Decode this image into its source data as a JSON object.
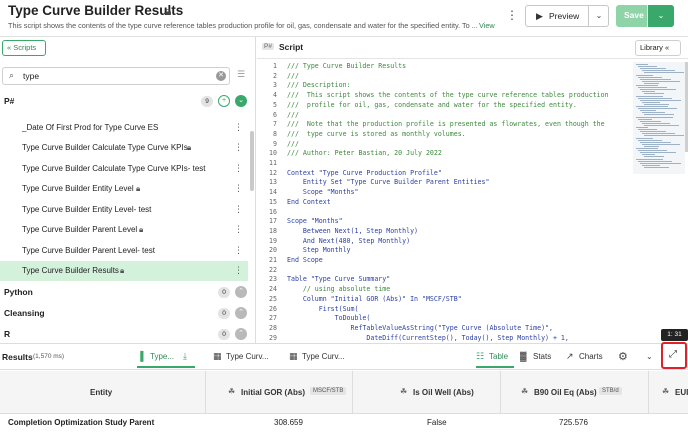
{
  "header": {
    "title": "Type Curve Builder Results",
    "description": "This script shows the contents of the type curve reference tables production profile for oil, gas, condensate and water for the specified entity. To ...",
    "view_link": "View",
    "preview_label": "Preview",
    "save_label": "Save"
  },
  "sidebar": {
    "scripts_button": "Scripts",
    "search": {
      "value": "type"
    },
    "groups": [
      {
        "label": "P#",
        "count": "9"
      },
      {
        "label": "Python",
        "count": "0"
      },
      {
        "label": "Cleansing",
        "count": "0"
      },
      {
        "label": "R",
        "count": "0"
      }
    ],
    "items": [
      {
        "label": "_Date Of First Prod for Type Curve ES",
        "locked": false
      },
      {
        "label": "Type Curve Builder Calculate Type Curve KPIs",
        "locked": true
      },
      {
        "label": "Type Curve Builder Calculate Type Curve KPIs- test",
        "locked": false
      },
      {
        "label": "Type Curve Builder Entity Level",
        "locked": true
      },
      {
        "label": "Type Curve Builder Entity Level- test",
        "locked": false
      },
      {
        "label": "Type Curve Builder Parent Level",
        "locked": true
      },
      {
        "label": "Type Curve Builder Parent Level- test",
        "locked": false
      },
      {
        "label": "Type Curve Builder Results",
        "locked": true,
        "selected": true
      }
    ]
  },
  "editor": {
    "tag": "P#",
    "title": "Script",
    "library_button": "Library",
    "lines": [
      {
        "n": "1",
        "text": "/// Type Curve Builder Results",
        "kind": "com"
      },
      {
        "n": "2",
        "text": "///",
        "kind": "com"
      },
      {
        "n": "3",
        "text": "/// Description:",
        "kind": "com"
      },
      {
        "n": "4",
        "text": "///  This script shows the contents of the type curve reference tables production",
        "kind": "com"
      },
      {
        "n": "5",
        "text": "///  profile for oil, gas, condensate and water for the specified entity.",
        "kind": "com"
      },
      {
        "n": "6",
        "text": "///",
        "kind": "com"
      },
      {
        "n": "7",
        "text": "///  Note that the production profile is presented as flowrates, even though the",
        "kind": "com"
      },
      {
        "n": "8",
        "text": "///  type curve is stored as monthly volumes.",
        "kind": "com"
      },
      {
        "n": "9",
        "text": "///",
        "kind": "com"
      },
      {
        "n": "10",
        "text": "/// Author: Peter Bastian, 20 July 2022",
        "kind": "com"
      },
      {
        "n": "11",
        "text": "",
        "kind": "plain"
      },
      {
        "n": "12",
        "text": "Context \"Type Curve Production Profile\"",
        "kind": "kw"
      },
      {
        "n": "13",
        "text": "    Entity Set \"Type Curve Builder Parent Entities\"",
        "kind": "kw"
      },
      {
        "n": "14",
        "text": "    Scope \"Months\"",
        "kind": "kw"
      },
      {
        "n": "15",
        "text": "End Context",
        "kind": "kw"
      },
      {
        "n": "16",
        "text": "",
        "kind": "plain"
      },
      {
        "n": "17",
        "text": "Scope \"Months\"",
        "kind": "kw"
      },
      {
        "n": "18",
        "text": "    Between Next(1, Step Monthly)",
        "kind": "kw"
      },
      {
        "n": "19",
        "text": "    And Next(480, Step Monthly)",
        "kind": "kw"
      },
      {
        "n": "20",
        "text": "    Step Monthly",
        "kind": "kw"
      },
      {
        "n": "21",
        "text": "End Scope",
        "kind": "kw"
      },
      {
        "n": "22",
        "text": "",
        "kind": "plain"
      },
      {
        "n": "23",
        "text": "Table \"Type Curve Summary\"",
        "kind": "kw"
      },
      {
        "n": "24",
        "text": "    // using absolute time",
        "kind": "com"
      },
      {
        "n": "25",
        "text": "    Column \"Initial GOR (Abs)\" In \"MSCF/STB\"",
        "kind": "kw"
      },
      {
        "n": "26",
        "text": "        First(Sum(",
        "kind": "kw"
      },
      {
        "n": "27",
        "text": "            ToDouble(",
        "kind": "kw"
      },
      {
        "n": "28",
        "text": "                RefTableValueAsString(\"Type Curve (Absolute Time)\",",
        "kind": "kw"
      },
      {
        "n": "29",
        "text": "                    DateDiff(CurrentStep(), Today(), Step Monthly) + 1,",
        "kind": "kw"
      }
    ],
    "tooltip": "1: 31"
  },
  "results": {
    "title": "Results",
    "time": "(1,570 ms)",
    "tabs": [
      {
        "label": "Type...",
        "icon": "chart-bar-icon"
      },
      {
        "label": "Type Curv...",
        "icon": "calendar-icon"
      },
      {
        "label": "Type Curv...",
        "icon": "calendar-icon"
      }
    ],
    "view_tabs": [
      {
        "label": "Table"
      },
      {
        "label": "Stats"
      },
      {
        "label": "Charts"
      }
    ]
  },
  "table": {
    "columns": [
      {
        "label": "Entity",
        "unit": ""
      },
      {
        "label": "Initial GOR (Abs)",
        "unit": "MSCF/STB"
      },
      {
        "label": "Is Oil Well (Abs)",
        "unit": ""
      },
      {
        "label": "B90 Oil Eq (Abs)",
        "unit": "STB/d"
      },
      {
        "label": "EUI",
        "unit": ""
      }
    ],
    "rows": [
      [
        "Completion Optimization Study Parent",
        "308.659",
        "False",
        "725.576",
        ""
      ]
    ]
  }
}
